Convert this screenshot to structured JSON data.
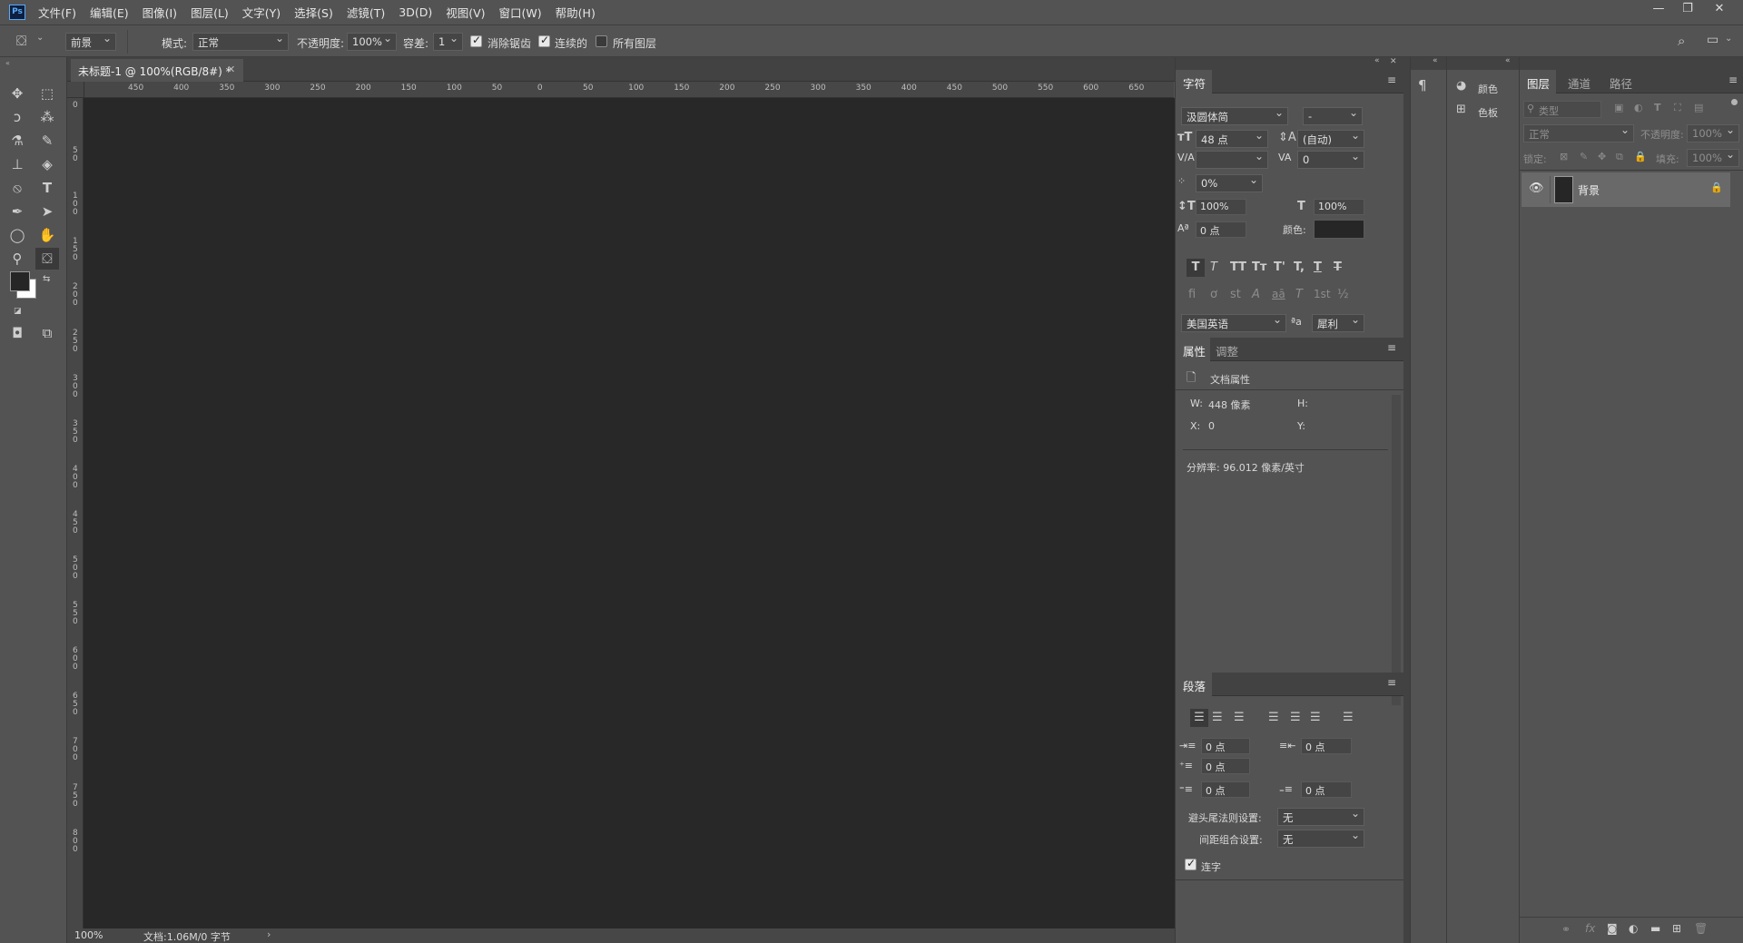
{
  "app": {
    "logo": "Ps",
    "menu": [
      "文件(F)",
      "编辑(E)",
      "图像(I)",
      "图层(L)",
      "文字(Y)",
      "选择(S)",
      "滤镜(T)",
      "3D(D)",
      "视图(V)",
      "窗口(W)",
      "帮助(H)"
    ],
    "window_controls": [
      "minimize-icon",
      "restore-icon",
      "close-icon"
    ]
  },
  "options": {
    "fill_source": "前景",
    "mode_label": "模式:",
    "mode_value": "正常",
    "opacity_label": "不透明度:",
    "opacity_value": "100%",
    "tolerance_label": "容差:",
    "tolerance_value": "1",
    "antialias_label": "消除锯齿",
    "antialias_checked": true,
    "contiguous_label": "连续的",
    "contiguous_checked": true,
    "all_layers_label": "所有图层",
    "all_layers_checked": false
  },
  "document": {
    "tab_title": "未标题-1 @ 100%(RGB/8#) *",
    "hruler_ticks": [
      "450",
      "400",
      "350",
      "300",
      "250",
      "200",
      "150",
      "100",
      "50",
      "0",
      "50",
      "100",
      "150",
      "200",
      "250",
      "300",
      "350",
      "400",
      "450",
      "500",
      "550",
      "600",
      "650"
    ],
    "vruler_ticks": [
      "0",
      "5 0",
      "1 0 0",
      "1 5 0",
      "2 0 0",
      "2 5 0",
      "3 0 0",
      "3 5 0",
      "4 0 0",
      "4 5 0",
      "5 0 0",
      "5 5 0",
      "6 0 0",
      "6 5 0",
      "7 0 0",
      "7 5 0",
      "8 0 0"
    ],
    "zoom": "100%",
    "doc_info": "文档:1.06M/0 字节",
    "canvas_color": "#282828"
  },
  "character": {
    "tab": "字符",
    "font_family": "汲圆体简",
    "font_style": "-",
    "size": "48 点",
    "leading": "(自动)",
    "kerning": "",
    "tracking": "0",
    "scale_tsume": "0%",
    "vscale": "100%",
    "hscale": "100%",
    "baseline": "0 点",
    "color_label": "颜色:",
    "color_value": "#262626",
    "style_buttons": [
      "T",
      "T",
      "TT",
      "Tт",
      "T'",
      "T,",
      "T",
      "T"
    ],
    "opentype_buttons": [
      "fi",
      "ơ",
      "st",
      "A",
      "aā",
      "T",
      "1st",
      "½"
    ],
    "language": "美国英语",
    "aa_icon": "ªa",
    "antialias": "犀利"
  },
  "properties": {
    "tabs": [
      "属性",
      "调整"
    ],
    "doc_label": "文档属性",
    "w_label": "W:",
    "w_value": "448 像素",
    "h_label": "H:",
    "x_label": "X:",
    "x_value": "0",
    "y_label": "Y:",
    "resolution": "分辨率: 96.012 像素/英寸"
  },
  "paragraph": {
    "tab": "段落",
    "indent_left": "0 点",
    "indent_right": "0 点",
    "first_line": "0 点",
    "space_before": "0 点",
    "space_after": "0 点",
    "kinsoku_label": "避头尾法则设置:",
    "kinsoku_value": "无",
    "mojikumi_label": "间距组合设置:",
    "mojikumi_value": "无",
    "hyphenate_label": "连字",
    "hyphenate_checked": true
  },
  "mini_panels": {
    "color_label": "颜色",
    "swatches_label": "色板"
  },
  "layers": {
    "tabs": [
      "图层",
      "通道",
      "路径"
    ],
    "filter_placeholder": "类型",
    "blend_mode": "正常",
    "opacity_label": "不透明度:",
    "opacity_value": "100%",
    "lock_label": "锁定:",
    "fill_label": "填充:",
    "fill_value": "100%",
    "items": [
      {
        "name": "背景",
        "visible": true,
        "locked": true
      }
    ]
  }
}
